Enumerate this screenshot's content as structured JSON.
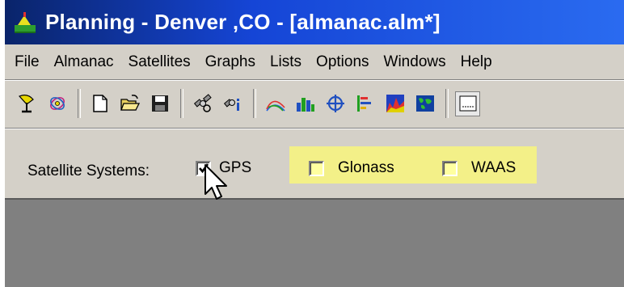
{
  "window": {
    "title": "Planning - Denver ,CO - [almanac.alm*]"
  },
  "menu": {
    "items": [
      "File",
      "Almanac",
      "Satellites",
      "Graphs",
      "Lists",
      "Options",
      "Windows",
      "Help"
    ]
  },
  "toolbar": {
    "icons": [
      "satellite-dish-icon",
      "satellite-select-icon",
      "new-file-icon",
      "open-folder-icon",
      "save-disk-icon",
      "satellite-icon",
      "satellite-info-icon",
      "elevation-graph-icon",
      "bar-chart-icon",
      "crosshair-icon",
      "dop-chart-icon",
      "sky-plot-icon",
      "world-map-icon",
      "panel-icon"
    ]
  },
  "satellite_systems": {
    "label": "Satellite Systems:",
    "options": [
      {
        "label": "GPS",
        "checked": true
      },
      {
        "label": "Glonass",
        "checked": false
      },
      {
        "label": "WAAS",
        "checked": false
      }
    ],
    "highlight_color": "#f3f088"
  },
  "colors": {
    "title_bar_start": "#0a246a",
    "title_bar_end": "#2a6bf0",
    "window_face": "#d4d0c8",
    "workspace": "#808080"
  }
}
